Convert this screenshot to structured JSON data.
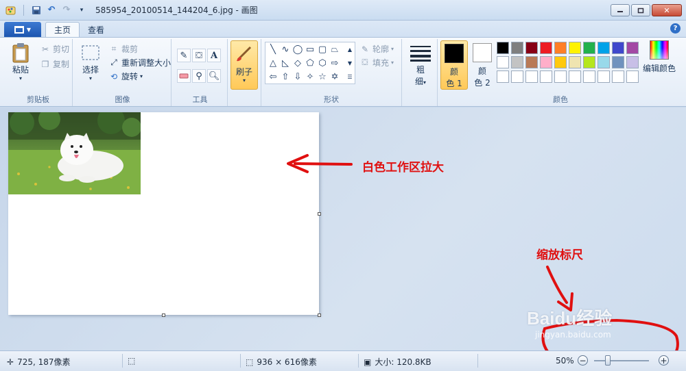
{
  "window": {
    "title": "585954_20100514_144204_6.jpg - 画图",
    "controls": {
      "minimize": "▭",
      "maximize": "▣",
      "close": "✕"
    }
  },
  "tabs": [
    {
      "label": "主页",
      "active": true
    },
    {
      "label": "查看",
      "active": false
    }
  ],
  "help": "?",
  "ribbon": {
    "clipboard": {
      "label": "剪贴板",
      "paste": "粘贴",
      "cut": "剪切",
      "copy": "复制"
    },
    "image": {
      "label": "图像",
      "select": "选择",
      "crop": "裁剪",
      "resize": "重新调整大小",
      "rotate": "旋转"
    },
    "tools": {
      "label": "工具",
      "text_tool": "A"
    },
    "brush": {
      "label": "刷子"
    },
    "shapes": {
      "label": "形状",
      "outline": "轮廓",
      "fill": "填充"
    },
    "size": {
      "label_line1": "粗",
      "label_line2": "细"
    },
    "colors": {
      "label": "颜色",
      "color1_label_line1": "颜",
      "color1_label_line2": "色 1",
      "color2_label_line1": "颜",
      "color2_label_line2": "色 2",
      "color1_value": "#000000",
      "color2_value": "#ffffff",
      "edit_label": "编辑颜色",
      "palette": [
        "#000000",
        "#7f7f7f",
        "#880015",
        "#ed1c24",
        "#ff7f27",
        "#fff200",
        "#22b14c",
        "#00a2e8",
        "#3f48cc",
        "#a349a4",
        "#ffffff",
        "#c3c3c3",
        "#b97a57",
        "#ffaec9",
        "#ffc90e",
        "#efe4b0",
        "#b5e61d",
        "#99d9ea",
        "#7092be",
        "#c8bfe7",
        "#ffffff",
        "#ffffff",
        "#ffffff",
        "#ffffff",
        "#ffffff",
        "#ffffff",
        "#ffffff",
        "#ffffff",
        "#ffffff",
        "#ffffff"
      ]
    }
  },
  "annotations": {
    "canvas_note": "白色工作区拉大",
    "zoom_note": "缩放标尺"
  },
  "watermark": {
    "logo": "Baidu经验",
    "url": "jingyan.baidu.com"
  },
  "status": {
    "cursor_pos": "725, 187像素",
    "image_dims": "936 × 616像素",
    "file_size": "大小: 120.8KB",
    "zoom": "50%",
    "zoom_level": 0.25
  }
}
